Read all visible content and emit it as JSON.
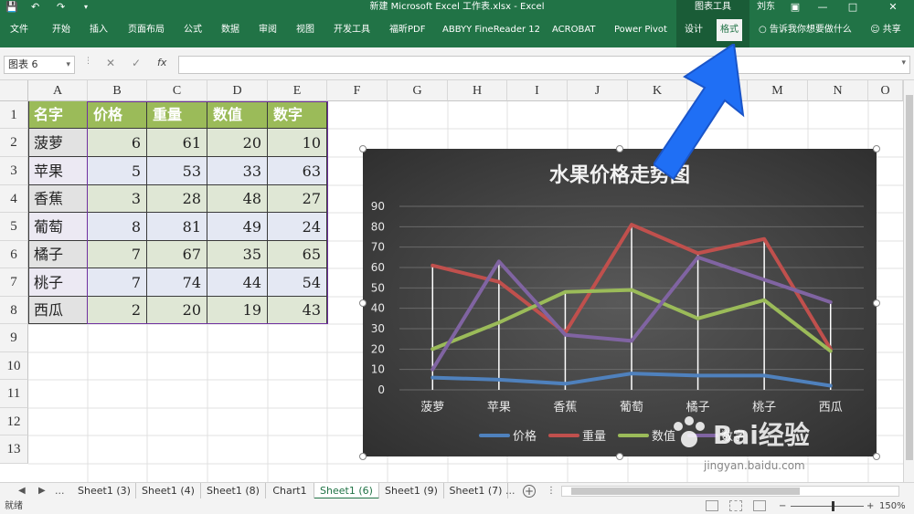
{
  "titlebar": {
    "title": "新建 Microsoft Excel 工作表.xlsx  -  Excel",
    "context_group": "图表工具",
    "user": "刘东",
    "save_icon": "save-icon",
    "undo_icon": "undo-icon",
    "redo_icon": "redo-icon"
  },
  "ribbon": {
    "tabs": [
      "文件",
      "开始",
      "插入",
      "页面布局",
      "公式",
      "数据",
      "审阅",
      "视图",
      "开发工具",
      "福昕PDF",
      "ABBYY FineReader 12",
      "ACROBAT",
      "Power Pivot",
      "设计",
      "格式"
    ],
    "active_tab": "格式",
    "tell_me": "告诉我你想要做什么",
    "share": "共享"
  },
  "formula_bar": {
    "name_box": "图表 6",
    "fx": "fx",
    "formula": ""
  },
  "columns": [
    "A",
    "B",
    "C",
    "D",
    "E",
    "F",
    "G",
    "H",
    "I",
    "J",
    "K",
    "L",
    "M",
    "N",
    "O"
  ],
  "rows": [
    "1",
    "2",
    "3",
    "4",
    "5",
    "6",
    "7",
    "8",
    "9",
    "10",
    "11",
    "12",
    "13"
  ],
  "table": {
    "headers": [
      "名字",
      "价格",
      "重量",
      "数值",
      "数字"
    ],
    "rows": [
      [
        "菠萝",
        "6",
        "61",
        "20",
        "10"
      ],
      [
        "苹果",
        "5",
        "53",
        "33",
        "63"
      ],
      [
        "香蕉",
        "3",
        "28",
        "48",
        "27"
      ],
      [
        "葡萄",
        "8",
        "81",
        "49",
        "24"
      ],
      [
        "橘子",
        "7",
        "67",
        "35",
        "65"
      ],
      [
        "桃子",
        "7",
        "74",
        "44",
        "54"
      ],
      [
        "西瓜",
        "2",
        "20",
        "19",
        "43"
      ]
    ]
  },
  "chart_data": {
    "type": "line",
    "title": "水果价格走势图",
    "categories": [
      "菠萝",
      "苹果",
      "香蕉",
      "葡萄",
      "橘子",
      "桃子",
      "西瓜"
    ],
    "ylim": [
      0,
      90
    ],
    "yticks": [
      "0",
      "10",
      "20",
      "30",
      "40",
      "50",
      "60",
      "70",
      "80",
      "90"
    ],
    "grid": true,
    "legend_position": "bottom",
    "series": [
      {
        "name": "价格",
        "color": "#4f81bd",
        "values": [
          6,
          5,
          3,
          8,
          7,
          7,
          2
        ]
      },
      {
        "name": "重量",
        "color": "#c0504d",
        "values": [
          61,
          53,
          28,
          81,
          67,
          74,
          20
        ]
      },
      {
        "name": "数值",
        "color": "#9bbb59",
        "values": [
          20,
          33,
          48,
          49,
          35,
          44,
          19
        ]
      },
      {
        "name": "数字",
        "color": "#8064a2",
        "values": [
          10,
          63,
          27,
          24,
          65,
          54,
          43
        ]
      }
    ]
  },
  "sheets": {
    "tabs": [
      "Sheet1 (3)",
      "Sheet1 (4)",
      "Sheet1 (8)",
      "Chart1",
      "Sheet1 (6)",
      "Sheet1 (9)",
      "Sheet1 (7)"
    ],
    "active": "Sheet1 (6)",
    "more": "...",
    "more_right": "..."
  },
  "statusbar": {
    "status": "就绪",
    "zoom": "150%"
  },
  "watermark": {
    "brand": "Bai经验",
    "url": "jingyan.baidu.com"
  }
}
